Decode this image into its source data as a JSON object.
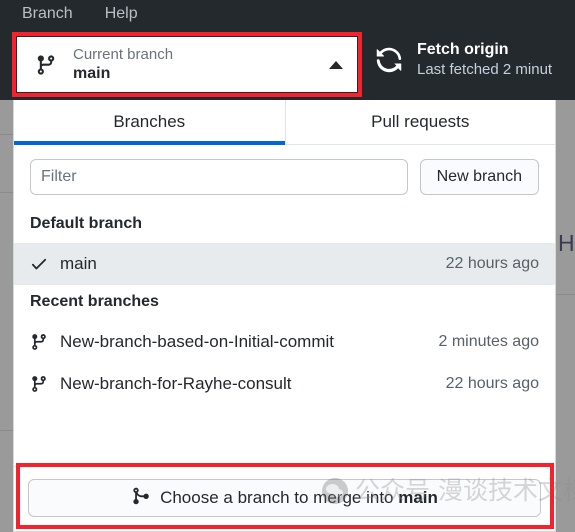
{
  "menubar": {
    "items": [
      {
        "label": "Branch"
      },
      {
        "label": "Help"
      }
    ]
  },
  "toolbar": {
    "current_branch": {
      "icon": "git-branch-icon",
      "caption": "Current branch",
      "name": "main",
      "caret": "chevron-up-icon"
    },
    "fetch": {
      "icon": "sync-icon",
      "title": "Fetch origin",
      "subtitle": "Last fetched 2 minut"
    }
  },
  "popup": {
    "tabs": [
      {
        "label": "Branches",
        "active": true
      },
      {
        "label": "Pull requests",
        "active": false
      }
    ],
    "filter": {
      "placeholder": "Filter",
      "value": ""
    },
    "new_branch_label": "New branch",
    "groups": [
      {
        "header": "Default branch",
        "rows": [
          {
            "icon": "check-icon",
            "label": "main",
            "time": "22 hours ago",
            "selected": true
          }
        ]
      },
      {
        "header": "Recent branches",
        "rows": [
          {
            "icon": "git-branch-icon",
            "label": "New-branch-based-on-Initial-commit",
            "time": "2 minutes ago",
            "selected": false
          },
          {
            "icon": "git-branch-icon",
            "label": "New-branch-for-Rayhe-consult",
            "time": "22 hours ago",
            "selected": false
          }
        ]
      }
    ],
    "merge": {
      "icon": "git-merge-icon",
      "prefix": "Choose a branch to merge into ",
      "target": "main"
    }
  },
  "annotations": {
    "color": "#f5222d",
    "boxes": [
      {
        "name": "current-branch-highlight"
      },
      {
        "name": "merge-button-highlight"
      }
    ]
  },
  "watermark": {
    "logo": "wechat-logo-icon",
    "text": "公众号 漫谈技术文档"
  },
  "backdrop": {
    "partial_glyph": "H"
  }
}
